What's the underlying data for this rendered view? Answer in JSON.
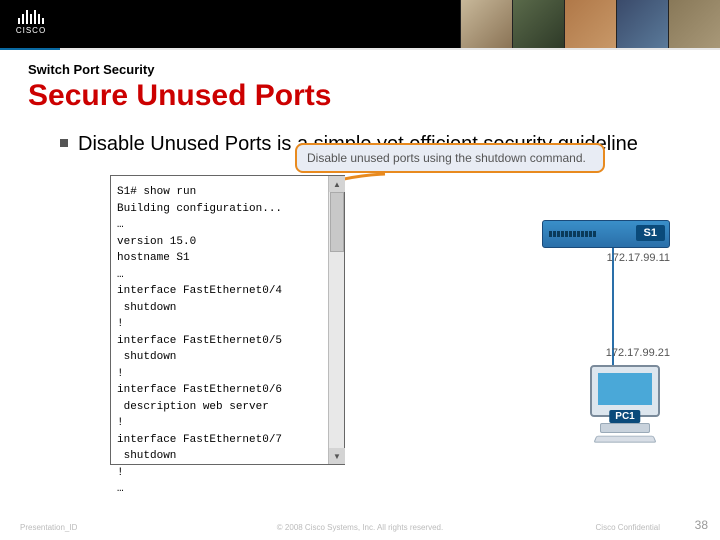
{
  "brand": {
    "name": "CISCO"
  },
  "pretitle": "Switch Port Security",
  "title": "Secure Unused Ports",
  "bullet": "Disable Unused Ports is a simple yet efficient security guideline",
  "callout": "Disable unused ports using the shutdown command.",
  "terminal": {
    "lines": [
      "S1# show run",
      "Building configuration...",
      "…",
      "version 15.0",
      "hostname S1",
      "…",
      "interface FastEthernet0/4",
      " shutdown",
      "!",
      "interface FastEthernet0/5",
      " shutdown",
      "!",
      "interface FastEthernet0/6",
      " description web server",
      "!",
      "interface FastEthernet0/7",
      " shutdown",
      "!",
      "…"
    ]
  },
  "devices": {
    "switch": {
      "label": "S1",
      "ip": "172.17.99.11"
    },
    "pc": {
      "label": "PC1",
      "ip": "172.17.99.21"
    }
  },
  "footer": {
    "left": "Presentation_ID",
    "center": "© 2008 Cisco Systems, Inc. All rights reserved.",
    "right": "Cisco Confidential",
    "page": "38"
  }
}
